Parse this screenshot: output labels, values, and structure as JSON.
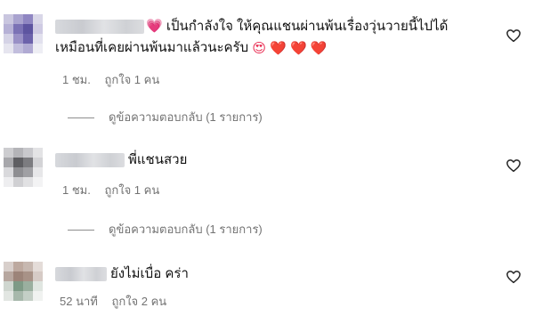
{
  "comments": [
    {
      "text_line1": "💗 เป็นกำลังใจ ให้คุณแชนผ่านพ้นเรื่องวุ่นวายนี้ไปได้",
      "text_line2_prefix": "เหมือนที่เคยผ่านพ้นมาแล้วนะครับ",
      "text_line2_emojis": "😍 ❤️ ❤️ ❤️",
      "time": "1 ชม.",
      "likes": "ถูกใจ 1 คน",
      "replies": "ดูข้อความตอบกลับ (1 รายการ)"
    },
    {
      "text_line1": "พี่แชนสวย",
      "time": "1 ชม.",
      "likes": "ถูกใจ 1 คน",
      "replies": "ดูข้อความตอบกลับ (1 รายการ)"
    },
    {
      "text_line1": "ยังไม่เบื่อ คร่า",
      "time": "52 นาที",
      "likes": "ถูกใจ 2 คน"
    }
  ]
}
